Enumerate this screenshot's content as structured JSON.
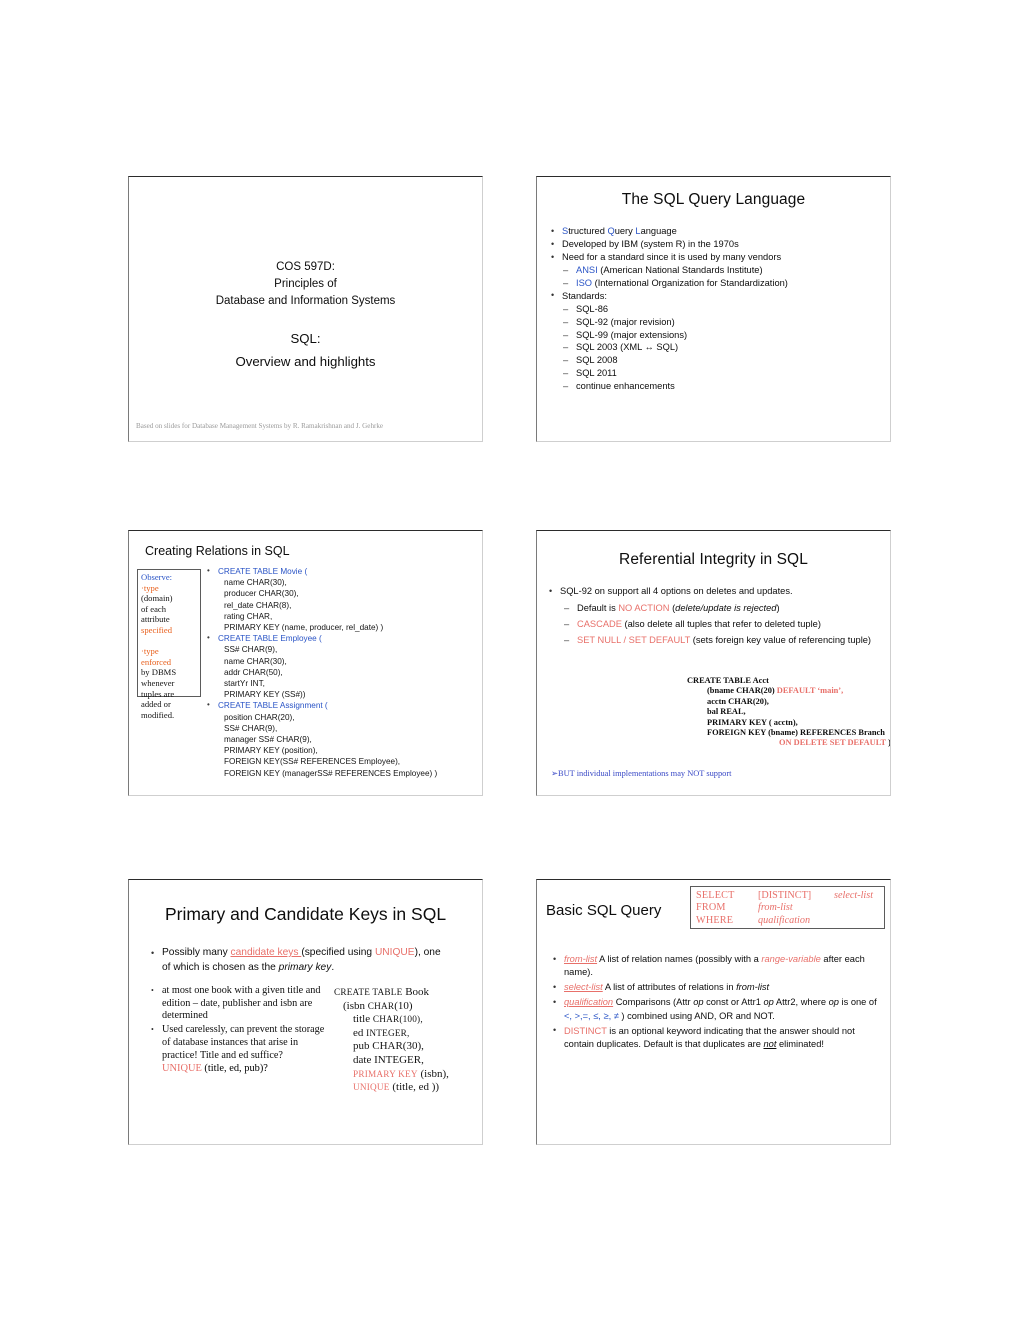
{
  "document": {
    "type": "lecture-slide-handout",
    "page_background": "#ffffff",
    "slide_count": 6
  },
  "colors": {
    "blue": "#2a54c6",
    "red": "#e8706a",
    "orange": "#e8601d",
    "text": "#0d0d0d",
    "footer_gray": "#9a9a9a",
    "border": "#5b5b5b"
  },
  "slide1": {
    "course_line1": "COS 597D:",
    "course_line2": "Principles of",
    "course_line3": "Database and Information Systems",
    "topic_line1": "SQL:",
    "topic_line2": "Overview and highlights",
    "footer": "Based on slides for Database Management Systems by R. Ramakrishnan and J. Gehrke"
  },
  "slide2": {
    "title": "The SQL Query Language",
    "bullets": [
      {
        "parts": [
          {
            "t": "S",
            "c": "blue"
          },
          {
            "t": "tructured "
          },
          {
            "t": "Q",
            "c": "blue"
          },
          {
            "t": "uery "
          },
          {
            "t": "L",
            "c": "blue"
          },
          {
            "t": "anguage"
          }
        ]
      },
      {
        "parts": [
          {
            "t": "Developed by IBM (system R) in the 1970s"
          }
        ]
      },
      {
        "parts": [
          {
            "t": "Need for a standard since it is used by many vendors"
          }
        ],
        "sub": [
          {
            "parts": [
              {
                "t": "ANSI",
                "c": "blue"
              },
              {
                "t": " (American National Standards Institute)"
              }
            ]
          },
          {
            "parts": [
              {
                "t": "ISO",
                "c": "blue"
              },
              {
                "t": " (International Organization for Standardization)"
              }
            ]
          }
        ]
      },
      {
        "parts": [
          {
            "t": "Standards:"
          }
        ],
        "sub": [
          {
            "parts": [
              {
                "t": "SQL-86"
              }
            ]
          },
          {
            "parts": [
              {
                "t": "SQL-92 (major revision)"
              }
            ]
          },
          {
            "parts": [
              {
                "t": "SQL-99 (major extensions)"
              }
            ]
          },
          {
            "parts": [
              {
                "t": "SQL 2003 (XML ↔ SQL)"
              }
            ]
          },
          {
            "parts": [
              {
                "t": "SQL 2008"
              }
            ]
          },
          {
            "parts": [
              {
                "t": "SQL 2011"
              }
            ]
          },
          {
            "parts": [
              {
                "t": "continue enhancements"
              }
            ]
          }
        ]
      }
    ]
  },
  "slide3": {
    "title": "Creating Relations in SQL",
    "observe_box": [
      {
        "t": "Observe:",
        "c": "blue"
      },
      {
        "t": "·type",
        "c": "orange"
      },
      {
        "t": "(domain)"
      },
      {
        "t": "of each"
      },
      {
        "t": "attribute"
      },
      {
        "t": "specified",
        "c": "orange"
      },
      {
        "t": " "
      },
      {
        "t": "·type",
        "c": "orange"
      },
      {
        "t": "enforced",
        "c": "orange"
      },
      {
        "t": "by DBMS"
      },
      {
        "t": "whenever"
      },
      {
        "t": "tuples  are"
      },
      {
        "t": "added or"
      },
      {
        "t": "modified."
      }
    ],
    "statements": [
      {
        "header": "CREATE TABLE Movie (",
        "lines": [
          "name CHAR(30),",
          "producer CHAR(30),",
          "rel_date CHAR(8),",
          "rating CHAR,",
          "PRIMARY KEY (name, producer, rel_date)  )"
        ]
      },
      {
        "header": "CREATE TABLE Employee (",
        "lines": [
          "SS# CHAR(9),",
          "name  CHAR(30),",
          "addr CHAR(50),",
          "startYr INT,",
          "PRIMARY KEY (SS#))"
        ]
      },
      {
        "header": "CREATE TABLE Assignment (",
        "lines": [
          "position  CHAR(20),",
          "SS#  CHAR(9),",
          "manager SS#  CHAR(9),",
          "PRIMARY KEY (position),",
          "FOREIGN KEY(SS# REFERENCES Employee),",
          "FOREIGN KEY (managerSS# REFERENCES Employee)   )"
        ]
      }
    ]
  },
  "slide4": {
    "title": "Referential Integrity in SQL",
    "bullet": "SQL-92 on support all 4 options on deletes and updates.",
    "subs": [
      {
        "parts": [
          {
            "t": "Default is "
          },
          {
            "t": "NO ACTION",
            "c": "red"
          },
          {
            "t": "   ("
          },
          {
            "t": "delete/update is rejected",
            "i": true
          },
          {
            "t": ")"
          }
        ]
      },
      {
        "parts": [
          {
            "t": "CASCADE",
            "c": "red"
          },
          {
            "t": "  (also delete all tuples that refer to deleted tuple)"
          }
        ]
      },
      {
        "parts": [
          {
            "t": "SET NULL / SET DEFAULT",
            "c": "red"
          },
          {
            "t": "  (sets foreign key value of referencing tuple)"
          }
        ]
      }
    ],
    "code": [
      {
        "indent": 0,
        "parts": [
          {
            "t": "CREATE TABLE Acct"
          }
        ]
      },
      {
        "indent": 1,
        "parts": [
          {
            "t": "(bname  CHAR(20) "
          },
          {
            "t": "DEFAULT ‘main’,",
            "c": "red"
          }
        ]
      },
      {
        "indent": 1,
        "parts": [
          {
            "t": "acctn  CHAR(20),"
          }
        ]
      },
      {
        "indent": 1,
        "parts": [
          {
            "t": "bal  REAL,"
          }
        ]
      },
      {
        "indent": 1,
        "parts": [
          {
            "t": "PRIMARY KEY ( acctn),"
          }
        ]
      },
      {
        "indent": 1,
        "parts": [
          {
            "t": "FOREIGN KEY (bname) REFERENCES Branch"
          }
        ]
      },
      {
        "indent": 2,
        "parts": [
          {
            "t": "ON DELETE SET DEFAULT",
            "c": "red"
          },
          {
            "t": " )"
          }
        ]
      }
    ],
    "note": "➢BUT individual implementations may NOT support"
  },
  "slide5": {
    "title": "Primary and Candidate Keys in SQL",
    "lead": {
      "parts": [
        {
          "t": "Possibly many "
        },
        {
          "t": "candidate keys ",
          "c": "red",
          "u": true
        },
        {
          "t": "(specified using "
        },
        {
          "t": "UNIQUE",
          "c": "red"
        },
        {
          "t": "), one of which is chosen as the "
        },
        {
          "t": "primary key",
          "i": true
        },
        {
          "t": "."
        }
      ]
    },
    "left_bullets": [
      "at most one book with a given title and edition – date, publisher and isbn are determined",
      "Used carelessly, can prevent the storage of database instances that arise in practice! Title and ed suffice?"
    ],
    "left_unique": {
      "kw": "UNIQUE",
      "rest": " (title, ed, pub)?"
    },
    "code": [
      {
        "indent": 0,
        "parts": [
          {
            "t": "CREATE TABLE",
            "sc": true
          },
          {
            "t": " Book"
          }
        ]
      },
      {
        "indent": 1,
        "parts": [
          {
            "t": "(isbn "
          },
          {
            "t": "CHAR",
            "sc": true
          },
          {
            "t": "(10)"
          }
        ]
      },
      {
        "indent": 2,
        "parts": [
          {
            "t": "title  "
          },
          {
            "t": "CHAR",
            "sc": true
          },
          {
            "t": "(100),",
            "sc": true
          }
        ]
      },
      {
        "indent": 2,
        "parts": [
          {
            "t": "ed "
          },
          {
            "t": "INTEGER,",
            "sc": true
          }
        ]
      },
      {
        "indent": 2,
        "parts": [
          {
            "t": "pub CHAR(30),"
          }
        ]
      },
      {
        "indent": 2,
        "parts": [
          {
            "t": "date INTEGER,"
          }
        ]
      },
      {
        "indent": 2,
        "parts": [
          {
            "t": "PRIMARY KEY",
            "c": "red",
            "sc": true
          },
          {
            "t": "  (isbn),"
          }
        ]
      },
      {
        "indent": 2,
        "parts": [
          {
            "t": "UNIQUE",
            "c": "red",
            "sc": true
          },
          {
            "t": " (title, ed ))"
          }
        ]
      }
    ]
  },
  "slide6": {
    "title": "Basic SQL Query",
    "query_box": [
      {
        "kw": "SELECT",
        "mid": "[DISTINCT]",
        "tail": "select-list"
      },
      {
        "kw": "FROM",
        "mid": "from-list",
        "tail": ""
      },
      {
        "kw": "WHERE",
        "mid": "qualification",
        "tail": ""
      }
    ],
    "bullets": [
      {
        "parts": [
          {
            "t": "from-list",
            "c": "red",
            "i": true,
            "u": true
          },
          {
            "t": "  A list of relation names (possibly with a "
          },
          {
            "t": "range-variable",
            "c": "red",
            "i": true
          },
          {
            "t": " after each name)."
          }
        ]
      },
      {
        "parts": [
          {
            "t": "select-list",
            "c": "red",
            "i": true,
            "u": true
          },
          {
            "t": "  A list of attributes of relations in "
          },
          {
            "t": "from-list",
            "i": true
          }
        ]
      },
      {
        "parts": [
          {
            "t": "qualification",
            "c": "red",
            "i": true,
            "u": true
          },
          {
            "t": "  Comparisons (Attr "
          },
          {
            "t": "op",
            "i": true
          },
          {
            "t": " const or Attr1 "
          },
          {
            "t": "op",
            "i": true
          },
          {
            "t": " Attr2, where "
          },
          {
            "t": "op",
            "i": true
          },
          {
            "t": " is one of "
          },
          {
            "t": "<, >,=, ≤, ≥, ≠",
            "c": "blue"
          },
          {
            "t": " )  combined using AND, OR and NOT."
          }
        ]
      },
      {
        "parts": [
          {
            "t": "DISTINCT",
            "c": "red"
          },
          {
            "t": " is an optional keyword indicating that the answer should not contain duplicates.  Default is that duplicates are "
          },
          {
            "t": "not",
            "i": true,
            "u": true
          },
          {
            "t": " eliminated!"
          }
        ]
      }
    ]
  }
}
